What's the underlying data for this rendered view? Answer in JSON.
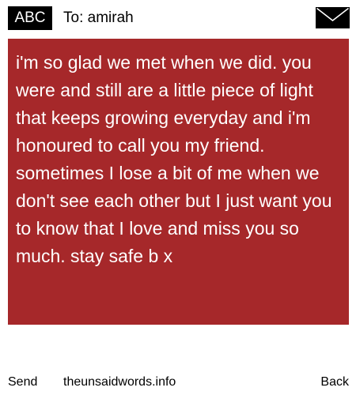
{
  "header": {
    "app_badge": "ABC",
    "recipient": "To: amirah",
    "icon": "envelope-icon"
  },
  "message": {
    "text": "i'm so glad we met when we did. you were and still are a little piece of light that keeps growing everyday and i'm honoured to call you my friend. sometimes I lose a bit of me when we don't see each other but I just want you to know that I love and miss you so much. stay safe b x",
    "background_color": "#a6282a",
    "text_color": "#ffffff"
  },
  "footer": {
    "send_label": "Send",
    "site_label": "theunsaidwords.info",
    "back_label": "Back"
  }
}
